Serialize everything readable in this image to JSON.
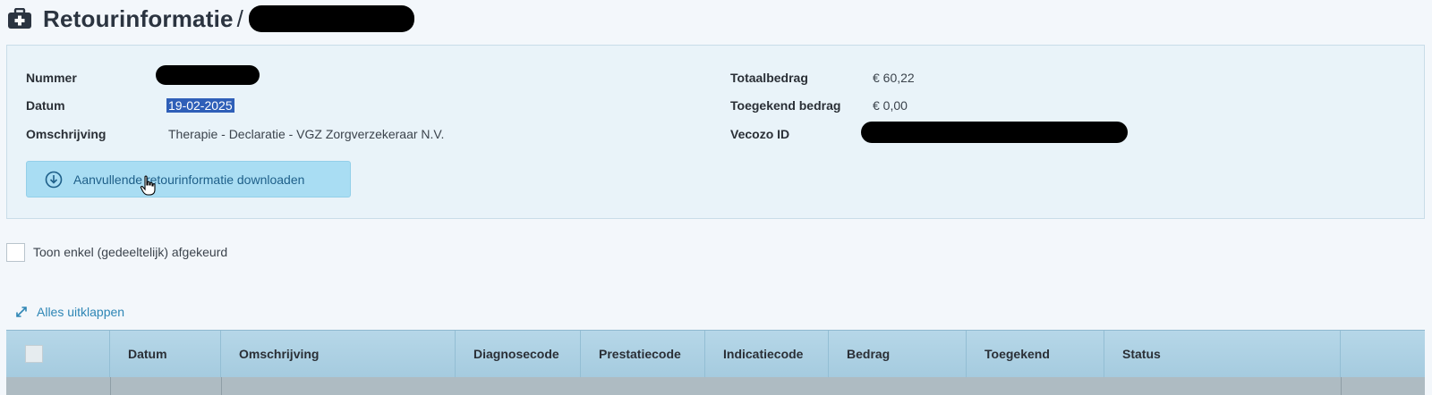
{
  "header": {
    "title": "Retourinformatie",
    "separator": "/",
    "icon": "medical-case-icon"
  },
  "info": {
    "nummer_label": "Nummer",
    "datum_label": "Datum",
    "datum_value": "19-02-2025",
    "omschrijving_label": "Omschrijving",
    "omschrijving_value": "Therapie - Declaratie - VGZ Zorgverzekeraar N.V.",
    "totaalbedrag_label": "Totaalbedrag",
    "totaalbedrag_value": "€ 60,22",
    "toegekend_label": "Toegekend bedrag",
    "toegekend_value": "€ 0,00",
    "vecozo_label": "Vecozo ID"
  },
  "download_button": {
    "label": "Aanvullende retourinformatie downloaden",
    "icon": "download-circle-icon"
  },
  "filter": {
    "label": "Toon enkel (gedeeltelijk) afgekeurd",
    "checked": false
  },
  "expand": {
    "label": "Alles uitklappen",
    "icon": "expand-arrows-icon"
  },
  "table": {
    "columns": [
      "Datum",
      "Omschrijving",
      "Diagnosecode",
      "Prestatiecode",
      "Indicatiecode",
      "Bedrag",
      "Toegekend",
      "Status"
    ]
  },
  "colors": {
    "accent": "#2e86b5",
    "button_bg": "#a9ddf3",
    "panel_bg": "#e9f3f9",
    "table_header_bg": "#b6d7e8"
  }
}
